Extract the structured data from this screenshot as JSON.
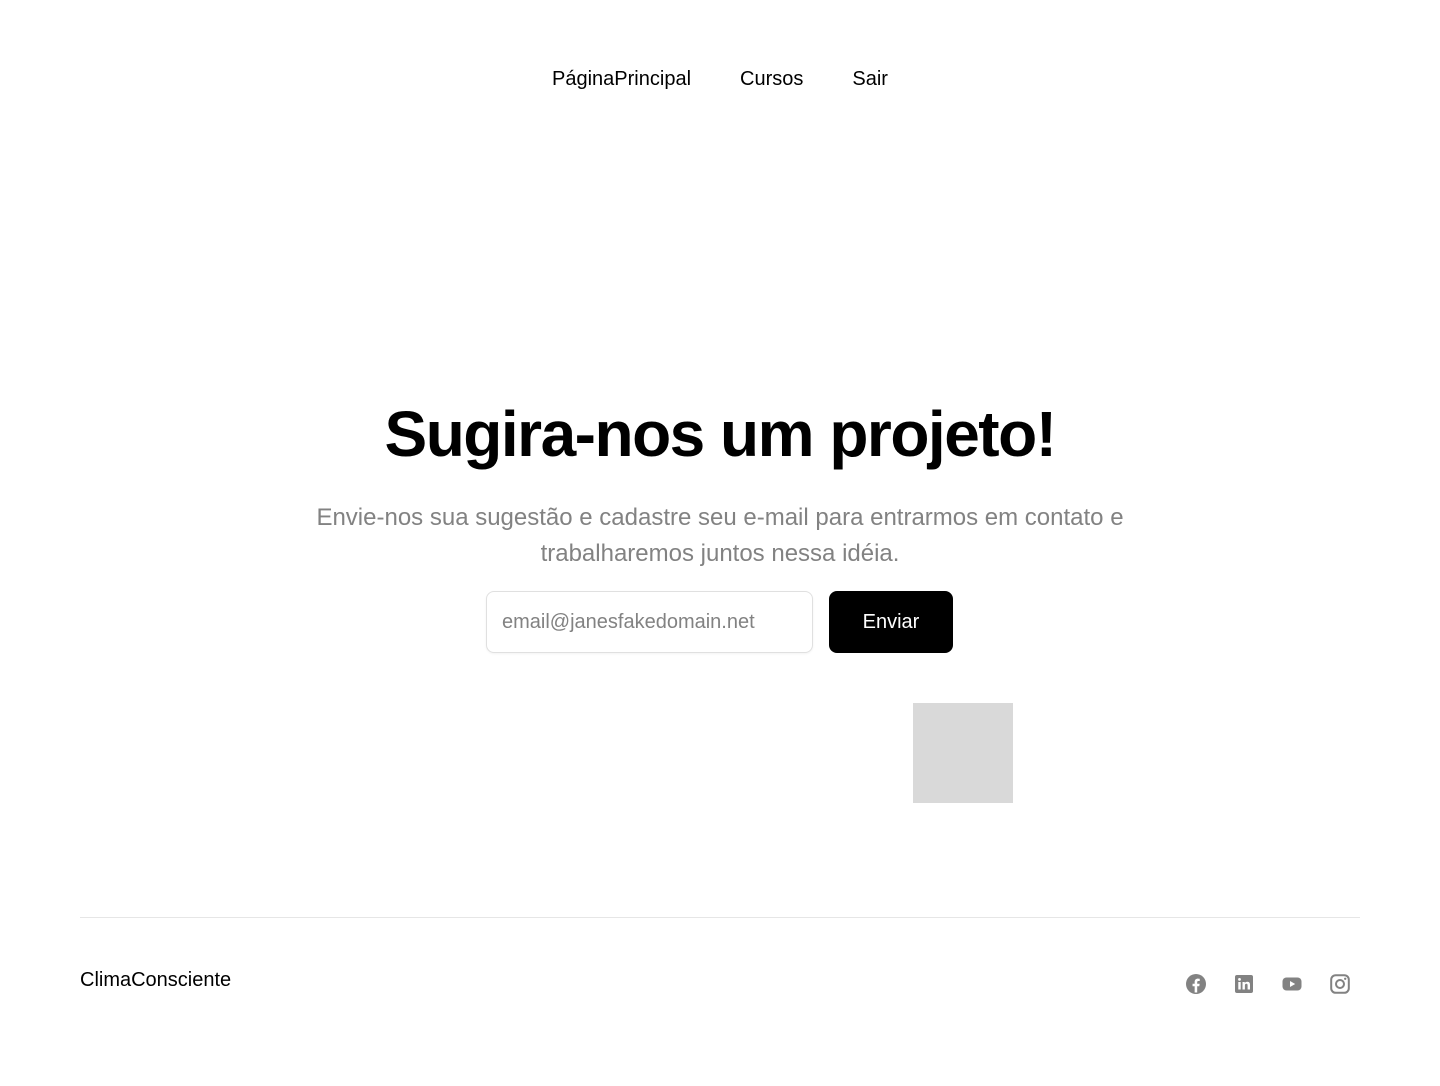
{
  "nav": {
    "items": [
      {
        "label": "PáginaPrincipal"
      },
      {
        "label": "Cursos"
      },
      {
        "label": "Sair"
      }
    ]
  },
  "hero": {
    "title": "Sugira-nos um projeto!",
    "subtitle": "Envie-nos sua sugestão e cadastre seu e-mail para entrarmos em contato e trabalharemos juntos nessa idéia."
  },
  "form": {
    "email_placeholder": "email@janesfakedomain.net",
    "email_value": "",
    "submit_label": "Enviar"
  },
  "footer": {
    "brand": "ClimaConsciente",
    "social_icons": [
      "facebook-icon",
      "linkedin-icon",
      "youtube-icon",
      "instagram-icon"
    ]
  },
  "colors": {
    "text": "#000000",
    "muted": "#828282",
    "button_bg": "#000000",
    "button_text": "#ffffff",
    "placeholder_box": "#d9d9d9",
    "icon": "#828282"
  }
}
